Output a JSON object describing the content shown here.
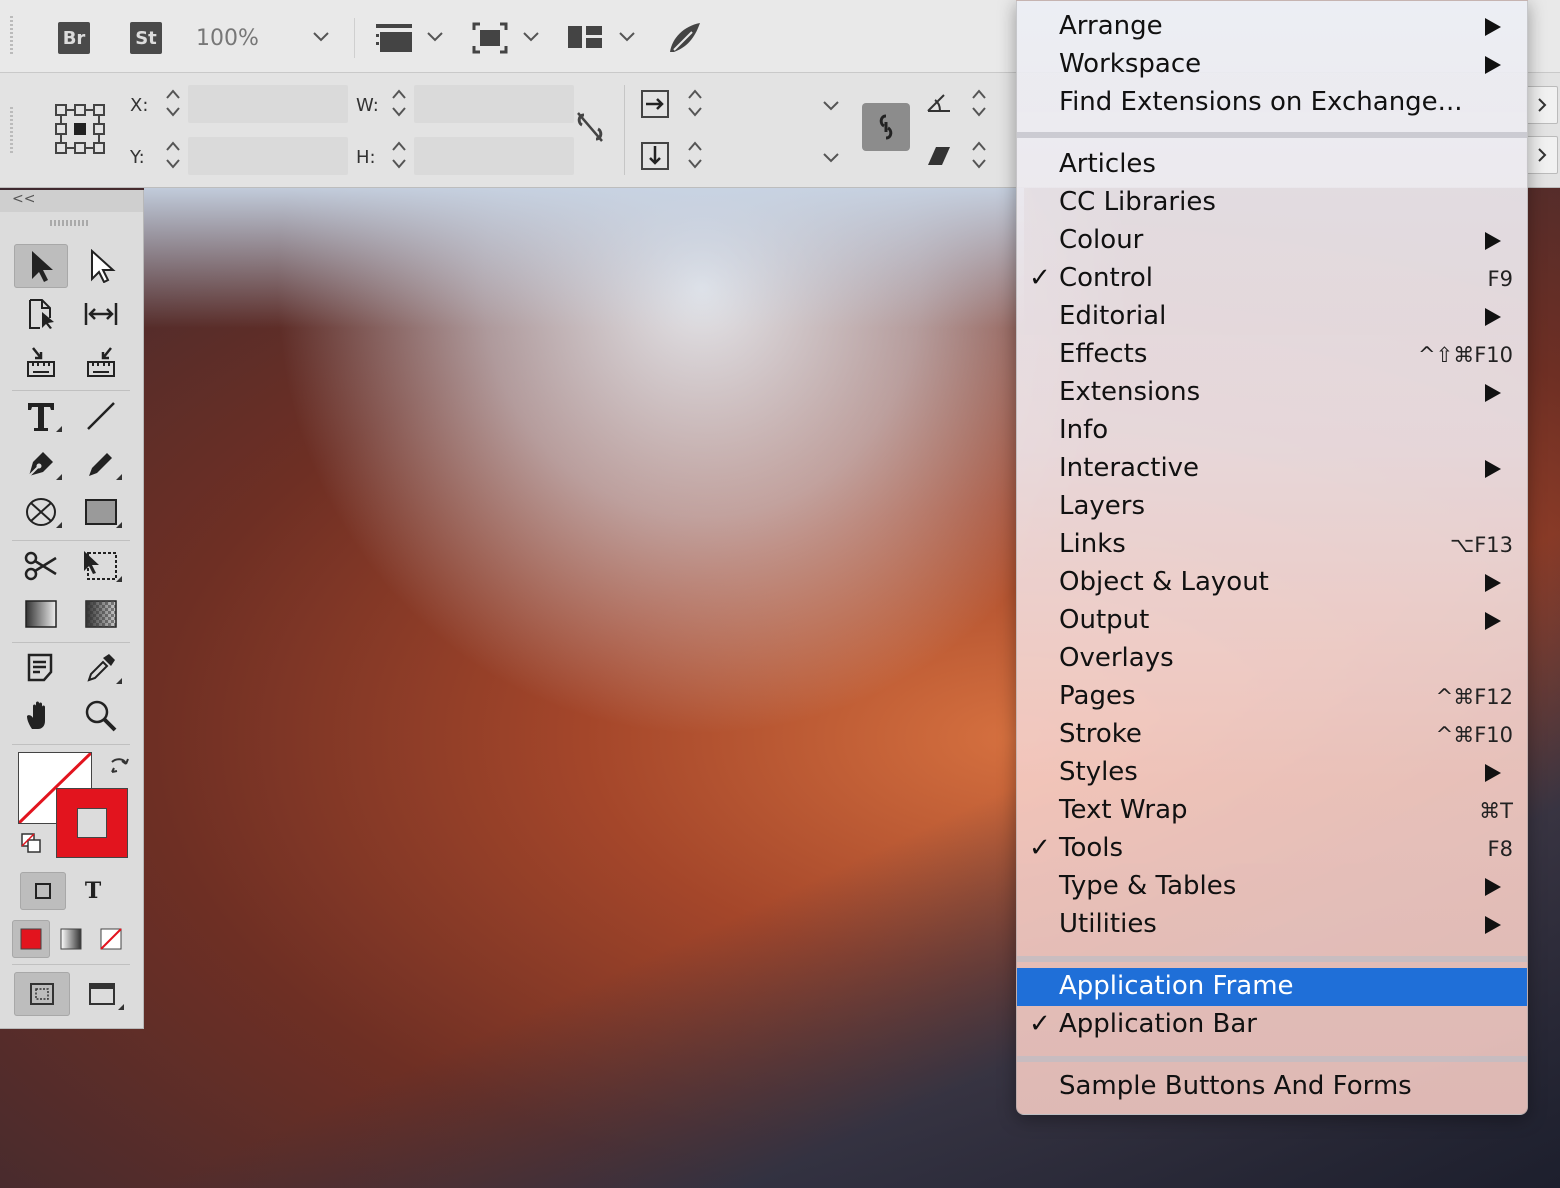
{
  "app_bar": {
    "bridge_badge": "Br",
    "stock_badge": "St",
    "zoom": "100%"
  },
  "control": {
    "x_label": "X:",
    "y_label": "Y:",
    "w_label": "W:",
    "h_label": "H:"
  },
  "tools": {
    "collapse": "<<",
    "type_mode_glyph": "T"
  },
  "menu": {
    "sections": [
      [
        {
          "label": "Arrange",
          "submenu": true
        },
        {
          "label": "Workspace",
          "submenu": true
        },
        {
          "label": "Find Extensions on Exchange..."
        }
      ],
      [
        {
          "label": "Articles"
        },
        {
          "label": "CC Libraries"
        },
        {
          "label": "Colour",
          "submenu": true
        },
        {
          "label": "Control",
          "checked": true,
          "shortcut": "F9"
        },
        {
          "label": "Editorial",
          "submenu": true
        },
        {
          "label": "Effects",
          "shortcut": "^⇧⌘F10"
        },
        {
          "label": "Extensions",
          "submenu": true
        },
        {
          "label": "Info"
        },
        {
          "label": "Interactive",
          "submenu": true
        },
        {
          "label": "Layers"
        },
        {
          "label": "Links",
          "shortcut": "⌥F13"
        },
        {
          "label": "Object & Layout",
          "submenu": true
        },
        {
          "label": "Output",
          "submenu": true
        },
        {
          "label": "Overlays"
        },
        {
          "label": "Pages",
          "shortcut": "^⌘F12"
        },
        {
          "label": "Stroke",
          "shortcut": "^⌘F10"
        },
        {
          "label": "Styles",
          "submenu": true
        },
        {
          "label": "Text Wrap",
          "shortcut": "⌘T"
        },
        {
          "label": "Tools",
          "checked": true,
          "shortcut": "F8"
        },
        {
          "label": "Type & Tables",
          "submenu": true
        },
        {
          "label": "Utilities",
          "submenu": true
        }
      ],
      [
        {
          "label": "Application Frame",
          "highlighted": true
        },
        {
          "label": "Application Bar",
          "checked": true
        }
      ],
      [
        {
          "label": "Sample Buttons And Forms"
        }
      ]
    ],
    "check_glyph": "✓",
    "highlight_color": "#1f6fd8"
  },
  "colors": {
    "stroke_red": "#e2141e",
    "menu_highlight": "#1f6fd8"
  }
}
